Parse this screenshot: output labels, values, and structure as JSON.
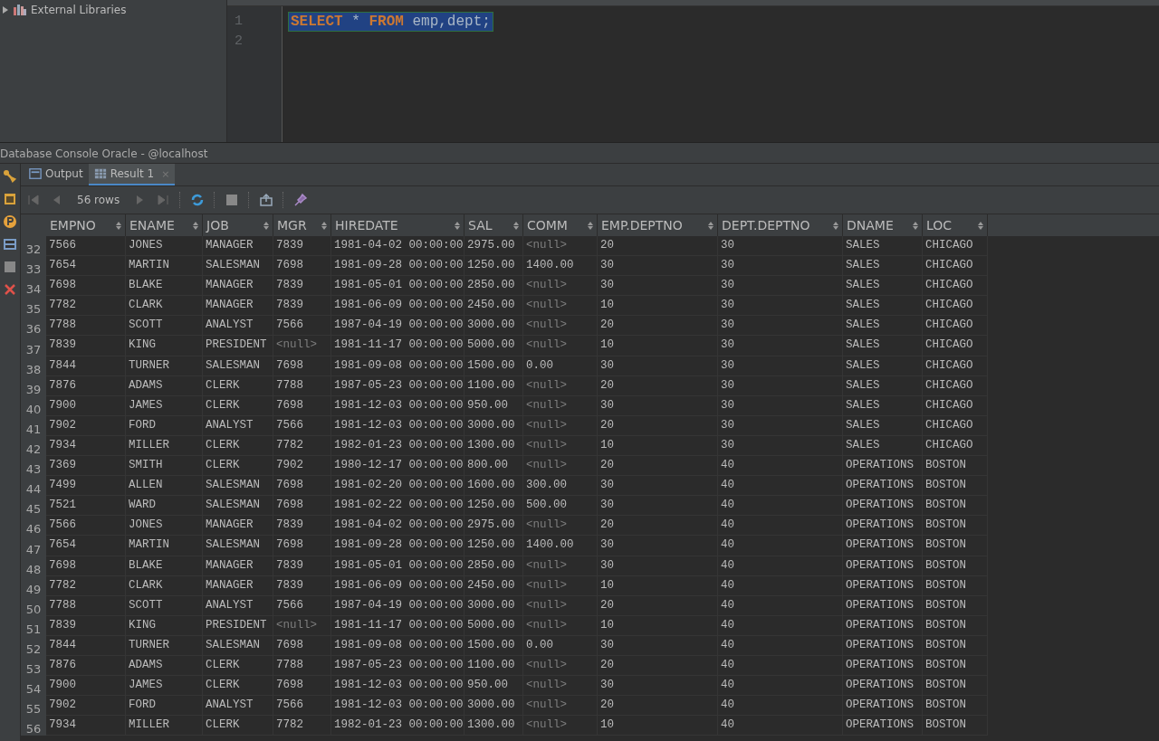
{
  "project_tree": {
    "items": [
      {
        "label": "External Libraries",
        "expanded": false
      }
    ]
  },
  "editor": {
    "lines": [
      {
        "number": "1",
        "tokens": [
          {
            "text": "SELECT",
            "kind": "keyword"
          },
          {
            "text": " * ",
            "kind": "plain"
          },
          {
            "text": "FROM",
            "kind": "keyword"
          },
          {
            "text": " emp,dept;",
            "kind": "plain"
          }
        ],
        "selected": true
      },
      {
        "number": "2"
      }
    ]
  },
  "console": {
    "title": "Database Console Oracle - @localhost",
    "tabs": [
      {
        "label": "Output",
        "selected": false
      },
      {
        "label": "Result 1",
        "selected": true,
        "close_label": "×"
      }
    ],
    "row_count": "56 rows"
  },
  "table": {
    "columns": [
      "EMPNO",
      "ENAME",
      "JOB",
      "MGR",
      "HIREDATE",
      "SAL",
      "COMM",
      "EMP.DEPTNO",
      "DEPT.DEPTNO",
      "DNAME",
      "LOC"
    ],
    "rows": [
      {
        "number": "32",
        "cells": [
          "7566",
          "JONES",
          "MANAGER",
          "7839",
          "1981-04-02 00:00:00",
          "2975.00",
          {
            "text": "<null>",
            "is_null": true
          },
          "20",
          "30",
          "SALES",
          "CHICAGO"
        ]
      },
      {
        "number": "33",
        "cells": [
          "7654",
          "MARTIN",
          "SALESMAN",
          "7698",
          "1981-09-28 00:00:00",
          "1250.00",
          "1400.00",
          "30",
          "30",
          "SALES",
          "CHICAGO"
        ]
      },
      {
        "number": "34",
        "cells": [
          "7698",
          "BLAKE",
          "MANAGER",
          "7839",
          "1981-05-01 00:00:00",
          "2850.00",
          {
            "text": "<null>",
            "is_null": true
          },
          "30",
          "30",
          "SALES",
          "CHICAGO"
        ]
      },
      {
        "number": "35",
        "cells": [
          "7782",
          "CLARK",
          "MANAGER",
          "7839",
          "1981-06-09 00:00:00",
          "2450.00",
          {
            "text": "<null>",
            "is_null": true
          },
          "10",
          "30",
          "SALES",
          "CHICAGO"
        ]
      },
      {
        "number": "36",
        "cells": [
          "7788",
          "SCOTT",
          "ANALYST",
          "7566",
          "1987-04-19 00:00:00",
          "3000.00",
          {
            "text": "<null>",
            "is_null": true
          },
          "20",
          "30",
          "SALES",
          "CHICAGO"
        ]
      },
      {
        "number": "37",
        "cells": [
          "7839",
          "KING",
          "PRESIDENT",
          {
            "text": "<null>",
            "is_null": true
          },
          "1981-11-17 00:00:00",
          "5000.00",
          {
            "text": "<null>",
            "is_null": true
          },
          "10",
          "30",
          "SALES",
          "CHICAGO"
        ]
      },
      {
        "number": "38",
        "cells": [
          "7844",
          "TURNER",
          "SALESMAN",
          "7698",
          "1981-09-08 00:00:00",
          "1500.00",
          "0.00",
          "30",
          "30",
          "SALES",
          "CHICAGO"
        ]
      },
      {
        "number": "39",
        "cells": [
          "7876",
          "ADAMS",
          "CLERK",
          "7788",
          "1987-05-23 00:00:00",
          "1100.00",
          {
            "text": "<null>",
            "is_null": true
          },
          "20",
          "30",
          "SALES",
          "CHICAGO"
        ]
      },
      {
        "number": "40",
        "cells": [
          "7900",
          "JAMES",
          "CLERK",
          "7698",
          "1981-12-03 00:00:00",
          "950.00",
          {
            "text": "<null>",
            "is_null": true
          },
          "30",
          "30",
          "SALES",
          "CHICAGO"
        ]
      },
      {
        "number": "41",
        "cells": [
          "7902",
          "FORD",
          "ANALYST",
          "7566",
          "1981-12-03 00:00:00",
          "3000.00",
          {
            "text": "<null>",
            "is_null": true
          },
          "20",
          "30",
          "SALES",
          "CHICAGO"
        ]
      },
      {
        "number": "42",
        "cells": [
          "7934",
          "MILLER",
          "CLERK",
          "7782",
          "1982-01-23 00:00:00",
          "1300.00",
          {
            "text": "<null>",
            "is_null": true
          },
          "10",
          "30",
          "SALES",
          "CHICAGO"
        ]
      },
      {
        "number": "43",
        "cells": [
          "7369",
          "SMITH",
          "CLERK",
          "7902",
          "1980-12-17 00:00:00",
          "800.00",
          {
            "text": "<null>",
            "is_null": true
          },
          "20",
          "40",
          "OPERATIONS",
          "BOSTON"
        ]
      },
      {
        "number": "44",
        "cells": [
          "7499",
          "ALLEN",
          "SALESMAN",
          "7698",
          "1981-02-20 00:00:00",
          "1600.00",
          "300.00",
          "30",
          "40",
          "OPERATIONS",
          "BOSTON"
        ]
      },
      {
        "number": "45",
        "cells": [
          "7521",
          "WARD",
          "SALESMAN",
          "7698",
          "1981-02-22 00:00:00",
          "1250.00",
          "500.00",
          "30",
          "40",
          "OPERATIONS",
          "BOSTON"
        ]
      },
      {
        "number": "46",
        "cells": [
          "7566",
          "JONES",
          "MANAGER",
          "7839",
          "1981-04-02 00:00:00",
          "2975.00",
          {
            "text": "<null>",
            "is_null": true
          },
          "20",
          "40",
          "OPERATIONS",
          "BOSTON"
        ]
      },
      {
        "number": "47",
        "cells": [
          "7654",
          "MARTIN",
          "SALESMAN",
          "7698",
          "1981-09-28 00:00:00",
          "1250.00",
          "1400.00",
          "30",
          "40",
          "OPERATIONS",
          "BOSTON"
        ]
      },
      {
        "number": "48",
        "cells": [
          "7698",
          "BLAKE",
          "MANAGER",
          "7839",
          "1981-05-01 00:00:00",
          "2850.00",
          {
            "text": "<null>",
            "is_null": true
          },
          "30",
          "40",
          "OPERATIONS",
          "BOSTON"
        ]
      },
      {
        "number": "49",
        "cells": [
          "7782",
          "CLARK",
          "MANAGER",
          "7839",
          "1981-06-09 00:00:00",
          "2450.00",
          {
            "text": "<null>",
            "is_null": true
          },
          "10",
          "40",
          "OPERATIONS",
          "BOSTON"
        ]
      },
      {
        "number": "50",
        "cells": [
          "7788",
          "SCOTT",
          "ANALYST",
          "7566",
          "1987-04-19 00:00:00",
          "3000.00",
          {
            "text": "<null>",
            "is_null": true
          },
          "20",
          "40",
          "OPERATIONS",
          "BOSTON"
        ]
      },
      {
        "number": "51",
        "cells": [
          "7839",
          "KING",
          "PRESIDENT",
          {
            "text": "<null>",
            "is_null": true
          },
          "1981-11-17 00:00:00",
          "5000.00",
          {
            "text": "<null>",
            "is_null": true
          },
          "10",
          "40",
          "OPERATIONS",
          "BOSTON"
        ]
      },
      {
        "number": "52",
        "cells": [
          "7844",
          "TURNER",
          "SALESMAN",
          "7698",
          "1981-09-08 00:00:00",
          "1500.00",
          "0.00",
          "30",
          "40",
          "OPERATIONS",
          "BOSTON"
        ]
      },
      {
        "number": "53",
        "cells": [
          "7876",
          "ADAMS",
          "CLERK",
          "7788",
          "1987-05-23 00:00:00",
          "1100.00",
          {
            "text": "<null>",
            "is_null": true
          },
          "20",
          "40",
          "OPERATIONS",
          "BOSTON"
        ]
      },
      {
        "number": "54",
        "cells": [
          "7900",
          "JAMES",
          "CLERK",
          "7698",
          "1981-12-03 00:00:00",
          "950.00",
          {
            "text": "<null>",
            "is_null": true
          },
          "30",
          "40",
          "OPERATIONS",
          "BOSTON"
        ]
      },
      {
        "number": "55",
        "cells": [
          "7902",
          "FORD",
          "ANALYST",
          "7566",
          "1981-12-03 00:00:00",
          "3000.00",
          {
            "text": "<null>",
            "is_null": true
          },
          "20",
          "40",
          "OPERATIONS",
          "BOSTON"
        ]
      },
      {
        "number": "56",
        "cells": [
          "7934",
          "MILLER",
          "CLERK",
          "7782",
          "1982-01-23 00:00:00",
          "1300.00",
          {
            "text": "<null>",
            "is_null": true
          },
          "10",
          "40",
          "OPERATIONS",
          "BOSTON"
        ]
      }
    ]
  }
}
